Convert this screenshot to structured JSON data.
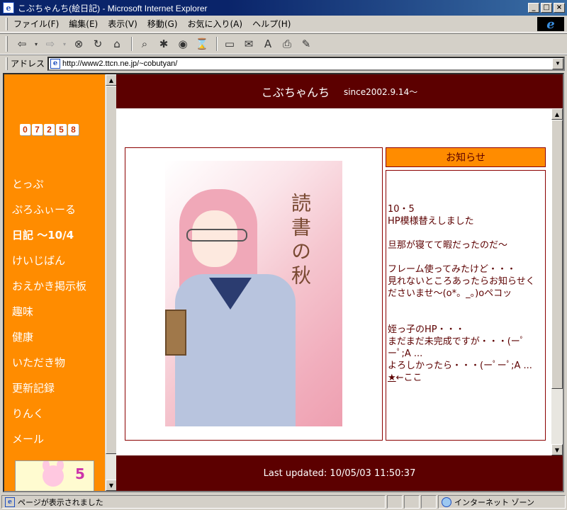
{
  "window": {
    "title": "こぶちゃんち(絵日記) - Microsoft Internet Explorer",
    "minimize": "_",
    "maximize": "□",
    "close": "×"
  },
  "menu": [
    "ファイル(F)",
    "編集(E)",
    "表示(V)",
    "移動(G)",
    "お気に入り(A)",
    "ヘルプ(H)"
  ],
  "address": {
    "label": "アドレス",
    "url": "http://www2.ttcn.ne.jp/~cobutyan/"
  },
  "left_frame": {
    "counter": [
      "0",
      "7",
      "2",
      "5",
      "8"
    ],
    "nav": [
      "とっぷ",
      "ぷろふぃーる",
      "日記 ～10/4",
      "けいじばん",
      "おえかき掲示板",
      "趣味",
      "健康",
      "いただき物",
      "更新記録",
      "りんく",
      "メール"
    ],
    "mascot_text": "5"
  },
  "header": {
    "title": "こぶちゃんち",
    "since": "since2002.9.14～"
  },
  "illustration": {
    "caption": "読書の秋"
  },
  "notice": {
    "heading": "お知らせ",
    "body": "10・5\nHP模様替えしました\n\n旦那が寝てて暇だったのだ～\n\nフレーム使ってみたけど・・・\n見れないところあったらお知らせくださいませ～(o*。_。)oペコッ\n\n\n姪っ子のHP・・・\nまだまだ未完成ですが・・・(ーﾟーﾟ;A ...\nよろしかったら・・・(ーﾟーﾟ;A ...",
    "star": "★",
    "star_link": "←ここ"
  },
  "footer": {
    "updated": "Last updated: 10/05/03 11:50:37"
  },
  "status": {
    "text": "ページが表示されました",
    "zone": "インターネット ゾーン"
  }
}
